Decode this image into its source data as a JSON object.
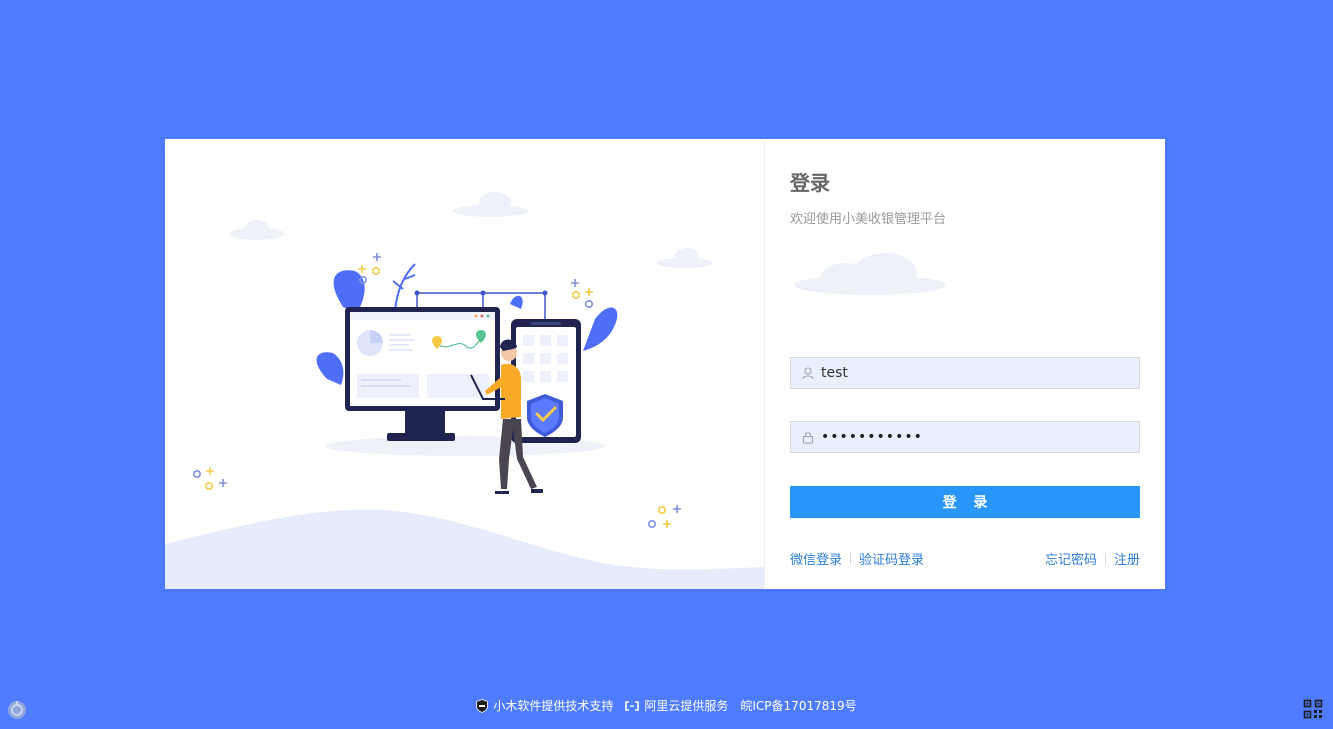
{
  "login": {
    "title": "登录",
    "subtitle": "欢迎使用小美收银管理平台",
    "username_value": "test",
    "password_dots": "•••••••••••",
    "submit_label": "登 录",
    "links_left": [
      "微信登录",
      "验证码登录"
    ],
    "links_right": [
      "忘记密码",
      "注册"
    ]
  },
  "footer": {
    "support": "小木软件提供技术支持",
    "cloud": "阿里云提供服务",
    "icp": "皖ICP备17017819号"
  },
  "icons": {
    "username": "user-icon",
    "password": "lock-icon",
    "support": "shield-badge-icon",
    "cloud": "aliyun-icon",
    "corner_left": "assistant-icon",
    "corner_right": "qrcode-icon"
  },
  "colors": {
    "background": "#4f7cff",
    "primary_button": "#2896fa",
    "link": "#2b7ed8",
    "input_fill": "#e8f0fe"
  }
}
